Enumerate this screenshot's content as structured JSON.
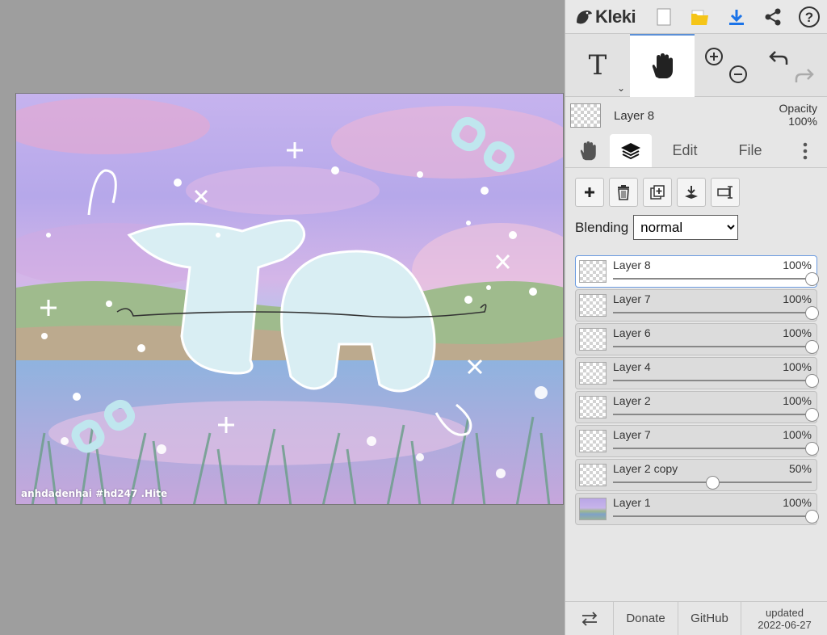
{
  "app": {
    "name": "Kleki"
  },
  "canvas": {
    "watermark": "anhdadenhai #hd247 .Hite"
  },
  "topbar": {
    "icons": [
      "new-image-icon",
      "open-folder-icon",
      "download-icon",
      "share-icon",
      "help-icon"
    ]
  },
  "tools": {
    "text_label": "T"
  },
  "current_layer": {
    "name": "Layer 8",
    "opacity_label": "Opacity",
    "opacity_value": "100%"
  },
  "tabs": {
    "edit": "Edit",
    "file": "File"
  },
  "blending": {
    "label": "Blending",
    "value": "normal"
  },
  "layers": [
    {
      "name": "Layer 8",
      "opacity": "100%",
      "value": 1.0,
      "selected": true,
      "thumb": "transparent"
    },
    {
      "name": "Layer 7",
      "opacity": "100%",
      "value": 1.0,
      "selected": false,
      "thumb": "transparent"
    },
    {
      "name": "Layer 6",
      "opacity": "100%",
      "value": 1.0,
      "selected": false,
      "thumb": "transparent"
    },
    {
      "name": "Layer 4",
      "opacity": "100%",
      "value": 1.0,
      "selected": false,
      "thumb": "transparent"
    },
    {
      "name": "Layer 2",
      "opacity": "100%",
      "value": 1.0,
      "selected": false,
      "thumb": "transparent"
    },
    {
      "name": "Layer 7",
      "opacity": "100%",
      "value": 1.0,
      "selected": false,
      "thumb": "transparent"
    },
    {
      "name": "Layer 2 copy",
      "opacity": "50%",
      "value": 0.5,
      "selected": false,
      "thumb": "transparent"
    },
    {
      "name": "Layer 1",
      "opacity": "100%",
      "value": 1.0,
      "selected": false,
      "thumb": "image"
    }
  ],
  "footer": {
    "donate": "Donate",
    "github": "GitHub",
    "updated_label": "updated",
    "updated_date": "2022-06-27"
  },
  "colors": {
    "accent": "#5a8fd6",
    "download": "#1a73e8",
    "folder": "#f5c518",
    "panel_bg": "#e6e6e6",
    "workspace_bg": "#9e9e9e"
  }
}
